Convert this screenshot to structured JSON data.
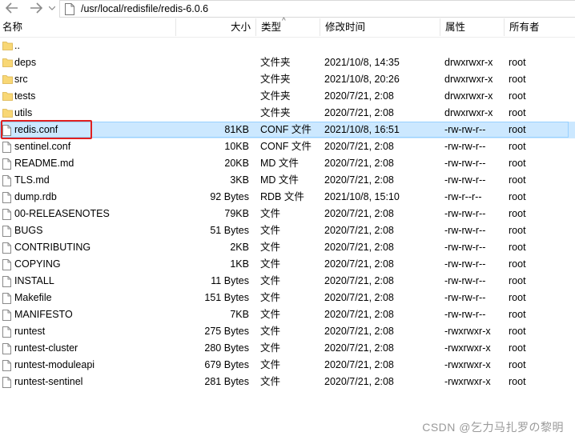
{
  "nav": {
    "path": "/usr/local/redisfile/redis-6.0.6"
  },
  "columns": {
    "name": "名称",
    "size": "大小",
    "type": "类型",
    "date": "修改时间",
    "perm": "属性",
    "owner": "所有者"
  },
  "rows": [
    {
      "name": "..",
      "size": "",
      "type": "",
      "date": "",
      "perm": "",
      "owner": "",
      "kind": "folder"
    },
    {
      "name": "deps",
      "size": "",
      "type": "文件夹",
      "date": "2021/10/8, 14:35",
      "perm": "drwxrwxr-x",
      "owner": "root",
      "kind": "folder"
    },
    {
      "name": "src",
      "size": "",
      "type": "文件夹",
      "date": "2021/10/8, 20:26",
      "perm": "drwxrwxr-x",
      "owner": "root",
      "kind": "folder"
    },
    {
      "name": "tests",
      "size": "",
      "type": "文件夹",
      "date": "2020/7/21, 2:08",
      "perm": "drwxrwxr-x",
      "owner": "root",
      "kind": "folder"
    },
    {
      "name": "utils",
      "size": "",
      "type": "文件夹",
      "date": "2020/7/21, 2:08",
      "perm": "drwxrwxr-x",
      "owner": "root",
      "kind": "folder"
    },
    {
      "name": "redis.conf",
      "size": "81KB",
      "type": "CONF 文件",
      "date": "2021/10/8, 16:51",
      "perm": "-rw-rw-r--",
      "owner": "root",
      "kind": "file",
      "selected": true
    },
    {
      "name": "sentinel.conf",
      "size": "10KB",
      "type": "CONF 文件",
      "date": "2020/7/21, 2:08",
      "perm": "-rw-rw-r--",
      "owner": "root",
      "kind": "file"
    },
    {
      "name": "README.md",
      "size": "20KB",
      "type": "MD 文件",
      "date": "2020/7/21, 2:08",
      "perm": "-rw-rw-r--",
      "owner": "root",
      "kind": "file"
    },
    {
      "name": "TLS.md",
      "size": "3KB",
      "type": "MD 文件",
      "date": "2020/7/21, 2:08",
      "perm": "-rw-rw-r--",
      "owner": "root",
      "kind": "file"
    },
    {
      "name": "dump.rdb",
      "size": "92 Bytes",
      "type": "RDB 文件",
      "date": "2021/10/8, 15:10",
      "perm": "-rw-r--r--",
      "owner": "root",
      "kind": "file"
    },
    {
      "name": "00-RELEASENOTES",
      "size": "79KB",
      "type": "文件",
      "date": "2020/7/21, 2:08",
      "perm": "-rw-rw-r--",
      "owner": "root",
      "kind": "file"
    },
    {
      "name": "BUGS",
      "size": "51 Bytes",
      "type": "文件",
      "date": "2020/7/21, 2:08",
      "perm": "-rw-rw-r--",
      "owner": "root",
      "kind": "file"
    },
    {
      "name": "CONTRIBUTING",
      "size": "2KB",
      "type": "文件",
      "date": "2020/7/21, 2:08",
      "perm": "-rw-rw-r--",
      "owner": "root",
      "kind": "file"
    },
    {
      "name": "COPYING",
      "size": "1KB",
      "type": "文件",
      "date": "2020/7/21, 2:08",
      "perm": "-rw-rw-r--",
      "owner": "root",
      "kind": "file"
    },
    {
      "name": "INSTALL",
      "size": "11 Bytes",
      "type": "文件",
      "date": "2020/7/21, 2:08",
      "perm": "-rw-rw-r--",
      "owner": "root",
      "kind": "file"
    },
    {
      "name": "Makefile",
      "size": "151 Bytes",
      "type": "文件",
      "date": "2020/7/21, 2:08",
      "perm": "-rw-rw-r--",
      "owner": "root",
      "kind": "file"
    },
    {
      "name": "MANIFESTO",
      "size": "7KB",
      "type": "文件",
      "date": "2020/7/21, 2:08",
      "perm": "-rw-rw-r--",
      "owner": "root",
      "kind": "file"
    },
    {
      "name": "runtest",
      "size": "275 Bytes",
      "type": "文件",
      "date": "2020/7/21, 2:08",
      "perm": "-rwxrwxr-x",
      "owner": "root",
      "kind": "file"
    },
    {
      "name": "runtest-cluster",
      "size": "280 Bytes",
      "type": "文件",
      "date": "2020/7/21, 2:08",
      "perm": "-rwxrwxr-x",
      "owner": "root",
      "kind": "file"
    },
    {
      "name": "runtest-moduleapi",
      "size": "679 Bytes",
      "type": "文件",
      "date": "2020/7/21, 2:08",
      "perm": "-rwxrwxr-x",
      "owner": "root",
      "kind": "file"
    },
    {
      "name": "runtest-sentinel",
      "size": "281 Bytes",
      "type": "文件",
      "date": "2020/7/21, 2:08",
      "perm": "-rwxrwxr-x",
      "owner": "root",
      "kind": "file"
    }
  ],
  "watermark": "CSDN @乞力马扎罗の黎明",
  "colors": {
    "selected_bg": "#cce8ff",
    "selected_border": "#99d1ff",
    "highlight": "#e02020",
    "folder": "#f8d775"
  }
}
